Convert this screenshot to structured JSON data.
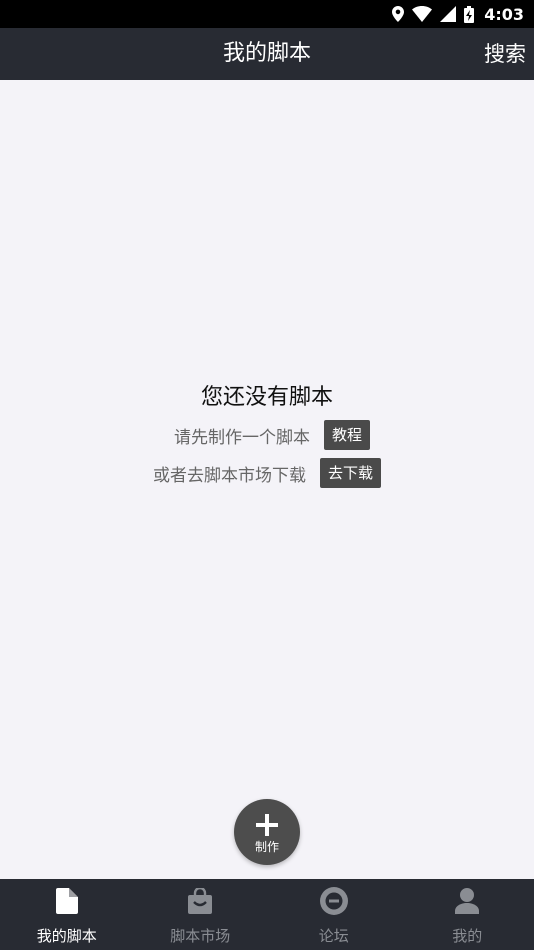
{
  "status_bar": {
    "time": "4:03",
    "icons": [
      "location-icon",
      "wifi-icon",
      "signal-icon",
      "battery-charging-icon"
    ]
  },
  "header": {
    "title": "我的脚本",
    "search_label": "搜索"
  },
  "empty_state": {
    "title": "您还没有脚本",
    "line1_text": "请先制作一个脚本",
    "line1_button": "教程",
    "line2_text": "或者去脚本市场下载",
    "line2_button": "去下载"
  },
  "fab": {
    "label": "制作",
    "icon": "plus-icon"
  },
  "bottom_nav": {
    "items": [
      {
        "label": "我的脚本",
        "icon": "document-icon",
        "active": true
      },
      {
        "label": "脚本市场",
        "icon": "shopping-bag-icon",
        "active": false
      },
      {
        "label": "论坛",
        "icon": "forum-icon",
        "active": false
      },
      {
        "label": "我的",
        "icon": "person-icon",
        "active": false
      }
    ]
  },
  "colors": {
    "bar_bg": "#282b33",
    "page_bg": "#f4f3f8",
    "button_bg": "#4a4a4a",
    "nav_active": "#ffffff",
    "nav_inactive": "#8a8d93"
  }
}
